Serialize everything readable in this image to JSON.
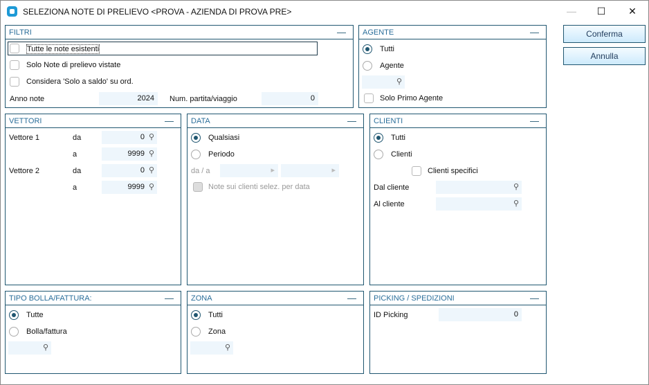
{
  "window": {
    "title": "SELEZIONA NOTE DI PRELIEVO <PROVA - AZIENDA DI PROVA PRE>",
    "minimize": "—",
    "maximize": "☐",
    "close": "✕"
  },
  "buttons": {
    "confirm": "Conferma",
    "cancel": "Annulla"
  },
  "collapse": "—",
  "filtri": {
    "title": "FILTRI",
    "all_notes": "Tutte le note esistenti",
    "only_viewed": "Solo Note di prelievo vistate",
    "consider_balance": "Considera 'Solo a saldo' su ord.",
    "year_label": "Anno note",
    "year_value": "2024",
    "batch_label": "Num. partita/viaggio",
    "batch_value": "0"
  },
  "agente": {
    "title": "AGENTE",
    "all": "Tutti",
    "agent": "Agente",
    "first_only": "Solo Primo Agente"
  },
  "vettori": {
    "title": "VETTORI",
    "v1": "Vettore 1",
    "v2": "Vettore 2",
    "from": "da",
    "to": "a",
    "v1_from": "0",
    "v1_to": "9999",
    "v2_from": "0",
    "v2_to": "9999"
  },
  "data": {
    "title": "DATA",
    "any": "Qualsiasi",
    "period": "Periodo",
    "range_label": "da / a",
    "by_date": "Note sui clienti selez. per data"
  },
  "clienti": {
    "title": "CLIENTI",
    "all": "Tutti",
    "clients": "Clienti",
    "specific": "Clienti specifici",
    "from": "Dal cliente",
    "to": "Al cliente"
  },
  "tipo": {
    "title": "TIPO BOLLA/FATTURA:",
    "all": "Tutte",
    "bolla": "Bolla/fattura"
  },
  "zona": {
    "title": "ZONA",
    "all": "Tutti",
    "zone": "Zona"
  },
  "picking": {
    "title": "PICKING / SPEDIZIONI",
    "id_label": "ID Picking",
    "id_value": "0"
  }
}
